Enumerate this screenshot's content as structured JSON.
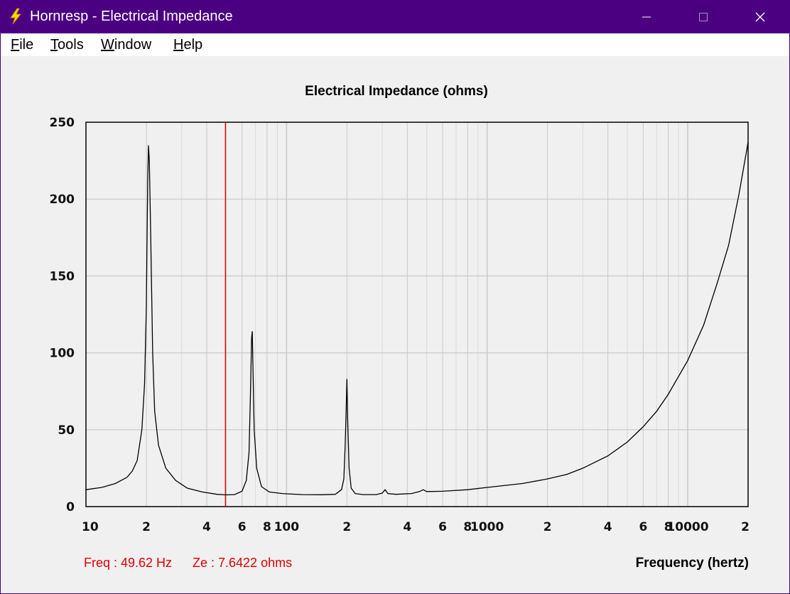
{
  "window": {
    "title": "Hornresp - Electrical Impedance",
    "controls": {
      "minimize_icon": "minimize-icon",
      "maximize_icon": "maximize-icon",
      "close_icon": "close-icon"
    },
    "titlebar_color": "#4b0082"
  },
  "menu": {
    "items": [
      {
        "first": "F",
        "rest": "ile"
      },
      {
        "first": "T",
        "rest": "ools"
      },
      {
        "first": "W",
        "rest": "indow"
      },
      {
        "first": "H",
        "rest": "elp"
      }
    ]
  },
  "status": {
    "freq": "Freq : 49.62 Hz",
    "ze": "Ze : 7.6422 ohms"
  },
  "chart_data": {
    "type": "line",
    "title": "Electrical Impedance (ohms)",
    "xlabel": "Frequency (hertz)",
    "ylabel": "",
    "x_scale": "log",
    "xlim": [
      10,
      20000
    ],
    "ylim": [
      0,
      250
    ],
    "yticks": [
      "0",
      "50",
      "100",
      "150",
      "200",
      "250"
    ],
    "xtick_labels": [
      {
        "value": 10,
        "label": "10"
      },
      {
        "value": 20,
        "label": "2"
      },
      {
        "value": 40,
        "label": "4"
      },
      {
        "value": 60,
        "label": "6"
      },
      {
        "value": 80,
        "label": "8"
      },
      {
        "value": 100,
        "label": "100"
      },
      {
        "value": 200,
        "label": "2"
      },
      {
        "value": 400,
        "label": "4"
      },
      {
        "value": 600,
        "label": "6"
      },
      {
        "value": 800,
        "label": "8"
      },
      {
        "value": 1000,
        "label": "1000"
      },
      {
        "value": 2000,
        "label": "2"
      },
      {
        "value": 4000,
        "label": "4"
      },
      {
        "value": 6000,
        "label": "6"
      },
      {
        "value": 8000,
        "label": "8"
      },
      {
        "value": 10000,
        "label": "10000"
      },
      {
        "value": 20000,
        "label": "2"
      }
    ],
    "grid": true,
    "cursor": {
      "frequency": 49.62,
      "color": "#e00000"
    },
    "line_color": "#000000",
    "series": [
      {
        "values": [
          [
            10,
            11
          ],
          [
            12,
            12.5
          ],
          [
            14,
            15
          ],
          [
            16,
            19
          ],
          [
            17,
            23
          ],
          [
            18,
            30
          ],
          [
            19,
            50
          ],
          [
            19.6,
            80
          ],
          [
            20,
            130
          ],
          [
            20.3,
            210
          ],
          [
            20.5,
            235
          ],
          [
            20.7,
            225
          ],
          [
            21,
            180
          ],
          [
            21.5,
            100
          ],
          [
            22,
            62
          ],
          [
            23,
            40
          ],
          [
            25,
            25
          ],
          [
            28,
            17
          ],
          [
            32,
            12
          ],
          [
            38,
            9.5
          ],
          [
            45,
            8
          ],
          [
            49.62,
            7.64
          ],
          [
            55,
            7.8
          ],
          [
            60,
            10
          ],
          [
            63,
            17
          ],
          [
            65,
            35
          ],
          [
            66,
            70
          ],
          [
            67,
            110
          ],
          [
            67.5,
            114
          ],
          [
            68,
            92
          ],
          [
            69,
            50
          ],
          [
            71,
            25
          ],
          [
            75,
            13
          ],
          [
            82,
            9.5
          ],
          [
            95,
            8.5
          ],
          [
            120,
            7.8
          ],
          [
            150,
            7.7
          ],
          [
            175,
            8
          ],
          [
            188,
            11
          ],
          [
            193,
            18
          ],
          [
            196,
            40
          ],
          [
            198,
            60
          ],
          [
            200,
            83
          ],
          [
            202,
            55
          ],
          [
            205,
            25
          ],
          [
            210,
            12
          ],
          [
            220,
            8.5
          ],
          [
            240,
            7.8
          ],
          [
            280,
            7.8
          ],
          [
            300,
            8.8
          ],
          [
            310,
            11
          ],
          [
            320,
            8.5
          ],
          [
            350,
            8
          ],
          [
            420,
            8.5
          ],
          [
            460,
            9.8
          ],
          [
            480,
            11
          ],
          [
            500,
            9.8
          ],
          [
            600,
            10
          ],
          [
            800,
            11
          ],
          [
            1000,
            12.5
          ],
          [
            1500,
            15
          ],
          [
            2000,
            18
          ],
          [
            2500,
            21
          ],
          [
            3000,
            25
          ],
          [
            4000,
            33
          ],
          [
            5000,
            42
          ],
          [
            6000,
            52
          ],
          [
            7000,
            62
          ],
          [
            8000,
            73
          ],
          [
            10000,
            95
          ],
          [
            12000,
            118
          ],
          [
            14000,
            145
          ],
          [
            16000,
            170
          ],
          [
            18000,
            203
          ],
          [
            20000,
            237
          ]
        ]
      }
    ]
  }
}
